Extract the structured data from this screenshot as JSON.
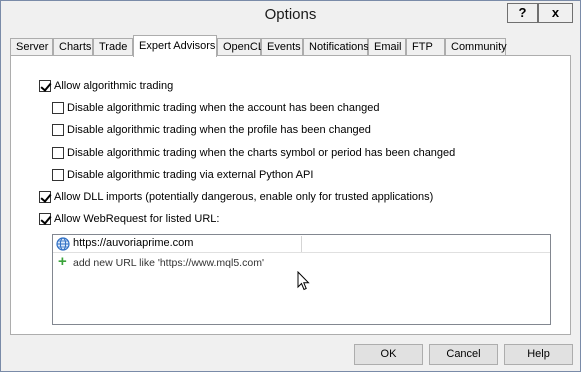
{
  "window": {
    "title": "Options",
    "help_button": "?",
    "close_button": "x"
  },
  "tabs": [
    {
      "label": "Server"
    },
    {
      "label": "Charts"
    },
    {
      "label": "Trade"
    },
    {
      "label": "Expert Advisors",
      "active": true
    },
    {
      "label": "OpenCL"
    },
    {
      "label": "Events"
    },
    {
      "label": "Notifications"
    },
    {
      "label": "Email"
    },
    {
      "label": "FTP"
    },
    {
      "label": "Community"
    }
  ],
  "options": {
    "allow_algo": {
      "label": "Allow algorithmic trading",
      "checked": true
    },
    "disable_account": {
      "label": "Disable algorithmic trading when the account has been changed",
      "checked": false
    },
    "disable_profile": {
      "label": "Disable algorithmic trading when the profile has been changed",
      "checked": false
    },
    "disable_symbol": {
      "label": "Disable algorithmic trading when the charts symbol or period has been changed",
      "checked": false
    },
    "disable_python": {
      "label": "Disable algorithmic trading via external Python API",
      "checked": false
    },
    "allow_dll": {
      "label": "Allow DLL imports (potentially dangerous, enable only for trusted applications)",
      "checked": true
    },
    "allow_webrequest": {
      "label": "Allow WebRequest for listed URL:",
      "checked": true
    }
  },
  "url_list": {
    "urls": [
      "https://auvoriaprime.com"
    ],
    "add_placeholder": "add new URL like 'https://www.mql5.com'"
  },
  "buttons": {
    "ok": "OK",
    "cancel": "Cancel",
    "help": "Help"
  }
}
